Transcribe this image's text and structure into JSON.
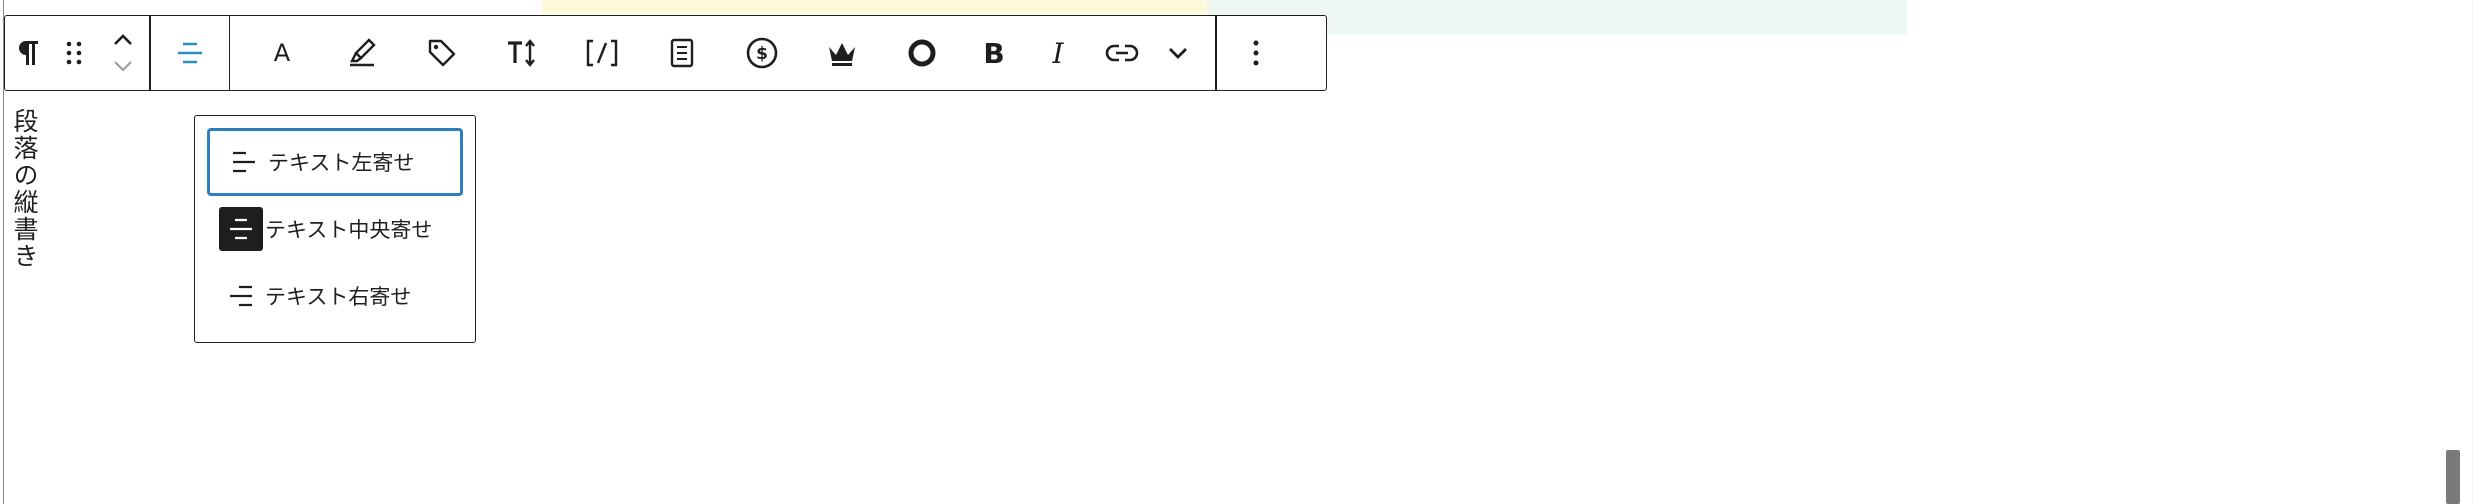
{
  "toolbar": {
    "buttons": [
      {
        "name": "paragraph",
        "label": "¶"
      },
      {
        "name": "drag",
        "label": "drag"
      },
      {
        "name": "move-up",
        "label": "up"
      },
      {
        "name": "move-down",
        "label": "down"
      },
      {
        "name": "align-center",
        "label": "align"
      },
      {
        "name": "font",
        "label": "A"
      },
      {
        "name": "highlighter",
        "label": "highlight"
      },
      {
        "name": "tag",
        "label": "tag"
      },
      {
        "name": "font-size",
        "label": "TT"
      },
      {
        "name": "shortcode",
        "label": "[/]"
      },
      {
        "name": "doc",
        "label": "doc"
      },
      {
        "name": "dollar",
        "label": "$"
      },
      {
        "name": "crown",
        "label": "crown"
      },
      {
        "name": "circle",
        "label": "O"
      },
      {
        "name": "bold",
        "label": "B"
      },
      {
        "name": "italic",
        "label": "I"
      },
      {
        "name": "link",
        "label": "link"
      },
      {
        "name": "more-formats",
        "label": "v"
      },
      {
        "name": "options",
        "label": "⋮"
      }
    ],
    "accent_color": "#2b8fbf"
  },
  "content": {
    "vertical_text": "段落の縦書き"
  },
  "alignment_menu": {
    "items": [
      {
        "label": "テキスト左寄せ",
        "focused": true,
        "active": false
      },
      {
        "label": "テキスト中央寄せ",
        "focused": false,
        "active": true
      },
      {
        "label": "テキスト右寄せ",
        "focused": false,
        "active": false
      }
    ],
    "focus_color": "#2b7fbf"
  },
  "toolbar_labels": {
    "font": "A",
    "bold": "B",
    "italic": "I"
  }
}
